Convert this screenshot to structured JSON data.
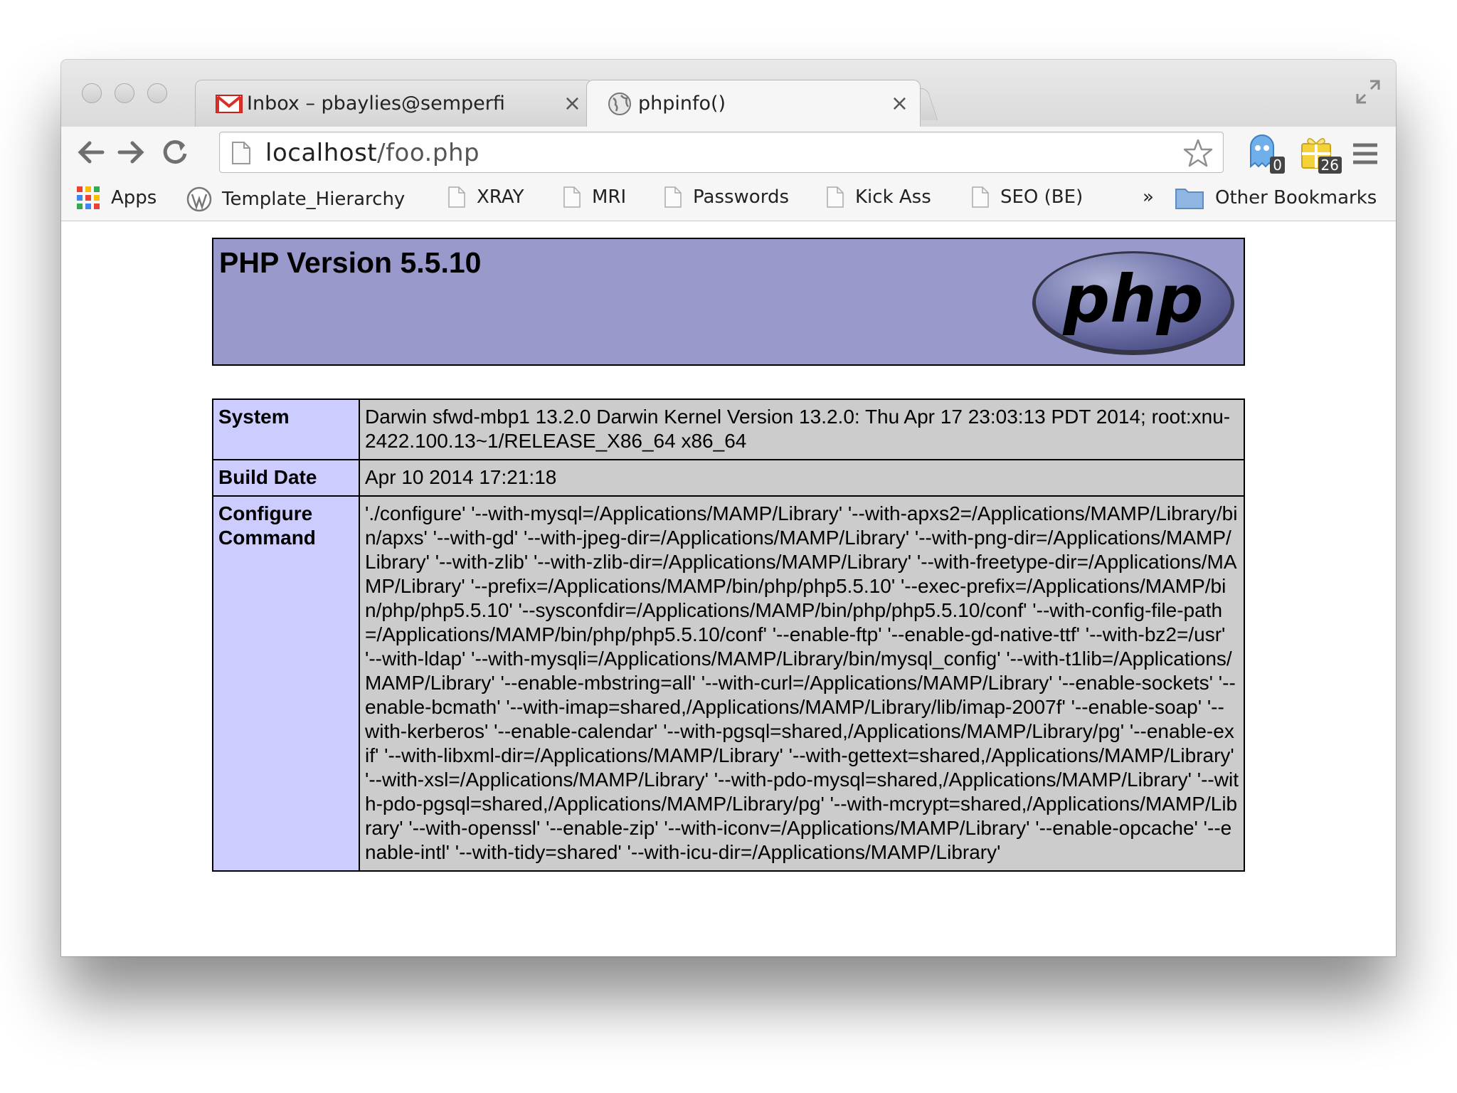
{
  "window": {
    "tabs": [
      {
        "label": "Inbox – pbaylies@semperfi",
        "icon": "gmail-icon",
        "active": false
      },
      {
        "label": "phpinfo()",
        "icon": "globe-icon",
        "active": true
      }
    ],
    "tab_close_glyph": "×"
  },
  "toolbar": {
    "url_host": "localhost",
    "url_path": "/foo.php",
    "extensions": [
      {
        "name": "ghost-extension-icon",
        "badge": "0"
      },
      {
        "name": "gift-extension-icon",
        "badge": "26"
      }
    ]
  },
  "bookmarks": {
    "apps_label": "Apps",
    "items": [
      {
        "label": "Template_Hierarchy",
        "icon": "wordpress-icon"
      },
      {
        "label": "XRAY",
        "icon": "page-icon"
      },
      {
        "label": "MRI",
        "icon": "page-icon"
      },
      {
        "label": "Passwords",
        "icon": "page-icon"
      },
      {
        "label": "Kick Ass",
        "icon": "page-icon"
      },
      {
        "label": "SEO (BE)",
        "icon": "page-icon"
      }
    ],
    "overflow_glyph": "»",
    "other_label": "Other Bookmarks"
  },
  "page": {
    "title": "PHP Version 5.5.10",
    "logo_text": "php",
    "rows": [
      {
        "key": "System",
        "value": "Darwin sfwd-mbp1 13.2.0 Darwin Kernel Version 13.2.0: Thu Apr 17 23:03:13 PDT 2014; root:xnu-2422.100.13~1/RELEASE_X86_64 x86_64"
      },
      {
        "key": "Build Date",
        "value": "Apr 10 2014 17:21:18"
      },
      {
        "key": "Configure Command",
        "value": "'./configure' '--with-mysql=/Applications/MAMP/Library' '--with-apxs2=/Applications/MAMP/Library/bin/apxs' '--with-gd' '--with-jpeg-dir=/Applications/MAMP/Library' '--with-png-dir=/Applications/MAMP/Library' '--with-zlib' '--with-zlib-dir=/Applications/MAMP/Library' '--with-freetype-dir=/Applications/MAMP/Library' '--prefix=/Applications/MAMP/bin/php/php5.5.10' '--exec-prefix=/Applications/MAMP/bin/php/php5.5.10' '--sysconfdir=/Applications/MAMP/bin/php/php5.5.10/conf' '--with-config-file-path=/Applications/MAMP/bin/php/php5.5.10/conf' '--enable-ftp' '--enable-gd-native-ttf' '--with-bz2=/usr' '--with-ldap' '--with-mysqli=/Applications/MAMP/Library/bin/mysql_config' '--with-t1lib=/Applications/MAMP/Library' '--enable-mbstring=all' '--with-curl=/Applications/MAMP/Library' '--enable-sockets' '--enable-bcmath' '--with-imap=shared,/Applications/MAMP/Library/lib/imap-2007f' '--enable-soap' '--with-kerberos' '--enable-calendar' '--with-pgsql=shared,/Applications/MAMP/Library/pg' '--enable-exif' '--with-libxml-dir=/Applications/MAMP/Library' '--with-gettext=shared,/Applications/MAMP/Library' '--with-xsl=/Applications/MAMP/Library' '--with-pdo-mysql=shared,/Applications/MAMP/Library' '--with-pdo-pgsql=shared,/Applications/MAMP/Library/pg' '--with-mcrypt=shared,/Applications/MAMP/Library' '--with-openssl' '--enable-zip' '--with-iconv=/Applications/MAMP/Library' '--enable-opcache' '--enable-intl' '--with-tidy=shared' '--with-icu-dir=/Applications/MAMP/Library'"
      }
    ]
  },
  "colors": {
    "header_bg": "#9999cc",
    "key_cell_bg": "#ccccff",
    "value_cell_bg": "#cccccc",
    "gmail_red": "#d93025"
  }
}
